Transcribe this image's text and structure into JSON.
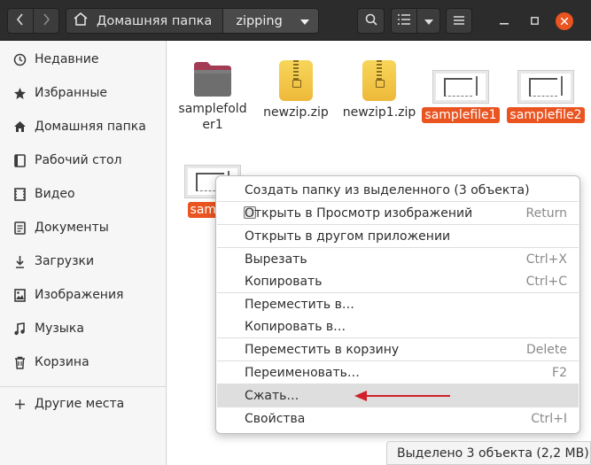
{
  "header": {
    "path_home": "Домашняя папка",
    "path_current": "zipping"
  },
  "sidebar": {
    "items": [
      {
        "label": "Недавние",
        "icon": "clock-icon"
      },
      {
        "label": "Избранные",
        "icon": "star-icon"
      },
      {
        "label": "Домашняя папка",
        "icon": "home-icon"
      },
      {
        "label": "Рабочий стол",
        "icon": "desktop-icon"
      },
      {
        "label": "Видео",
        "icon": "video-icon"
      },
      {
        "label": "Документы",
        "icon": "document-icon"
      },
      {
        "label": "Загрузки",
        "icon": "download-icon"
      },
      {
        "label": "Изображения",
        "icon": "image-icon"
      },
      {
        "label": "Музыка",
        "icon": "music-icon"
      },
      {
        "label": "Корзина",
        "icon": "trash-icon"
      }
    ],
    "other_places": "Другие места"
  },
  "files": [
    {
      "name_line1": "samplefold",
      "name_line2": "er1",
      "type": "folder",
      "selected": false
    },
    {
      "name": "newzip.zip",
      "type": "zip",
      "selected": false
    },
    {
      "name": "newzip1.zip",
      "type": "zip",
      "selected": false
    },
    {
      "name": "samplefile1",
      "type": "image",
      "selected": true
    },
    {
      "name": "samplefile2",
      "type": "image",
      "selected": true
    },
    {
      "name": "sample",
      "type": "image",
      "selected": true
    }
  ],
  "context_menu": {
    "items": [
      {
        "label": "Создать папку из выделенного (3 объекта)",
        "accel": ""
      },
      {
        "label": "Открыть в Просмотр изображений",
        "accel": "Return"
      },
      {
        "label": "Открыть в другом приложении",
        "accel": ""
      },
      {
        "label": "Вырезать",
        "accel": "Ctrl+X"
      },
      {
        "label": "Копировать",
        "accel": "Ctrl+C"
      },
      {
        "label": "Переместить в…",
        "accel": ""
      },
      {
        "label": "Копировать в…",
        "accel": ""
      },
      {
        "label": "Переместить в корзину",
        "accel": "Delete"
      },
      {
        "label": "Переименовать…",
        "accel": "F2"
      },
      {
        "label": "Сжать…",
        "accel": ""
      },
      {
        "label": "Свойства",
        "accel": "Ctrl+I"
      }
    ]
  },
  "status": "Выделено 3 объекта  (2,2 MB)",
  "colors": {
    "accent": "#e95420",
    "headerbar": "#2c2c2c",
    "annotation_arrow": "#d0202a"
  }
}
